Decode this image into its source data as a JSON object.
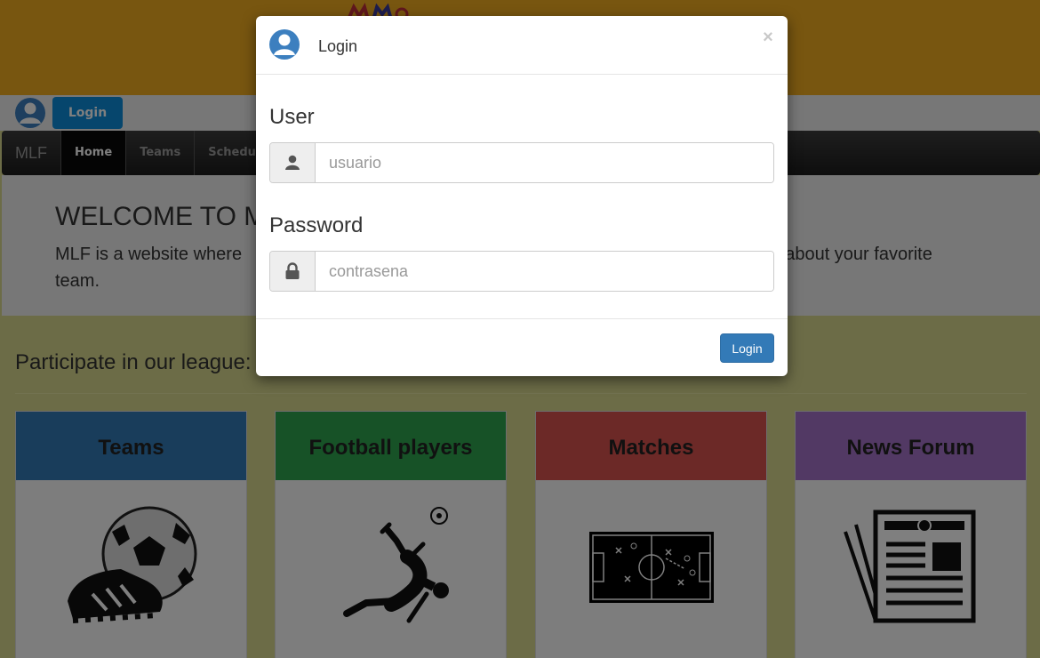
{
  "navbar": {
    "brand": "MLF",
    "items": [
      {
        "label": "Home"
      },
      {
        "label": "Teams"
      },
      {
        "label": "Schedule"
      }
    ]
  },
  "userbar": {
    "login_label": "Login"
  },
  "jumbotron": {
    "title": "WELCOME TO M",
    "text_part1": "MLF is a website where",
    "text_part2": "about your favorite",
    "text_part3": "team."
  },
  "section": {
    "title": "Participate in our league:"
  },
  "cards": [
    {
      "title": "Teams",
      "color": "#337ab7",
      "icon": "soccer-ball-and-boot-icon"
    },
    {
      "title": "Football players",
      "color": "#2ea44f",
      "icon": "bicycle-kick-player-icon"
    },
    {
      "title": "Matches",
      "color": "#d9534f",
      "icon": "tactics-board-icon"
    },
    {
      "title": "News Forum",
      "color": "#a473c9",
      "icon": "newspaper-icon"
    }
  ],
  "modal": {
    "title": "Login",
    "close": "×",
    "user_label": "User",
    "user_placeholder": "usuario",
    "password_label": "Password",
    "password_placeholder": "contrasena",
    "submit": "Login"
  },
  "colors": {
    "banner": "#f0ac20",
    "page_background": "#d9d98f",
    "login_top_button": "#0d8ddb",
    "primary_button": "#337ab7"
  }
}
